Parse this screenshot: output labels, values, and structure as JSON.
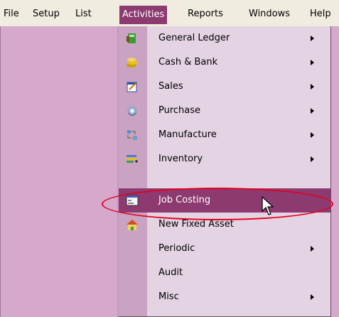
{
  "menubar": {
    "items": [
      "File",
      "Setup",
      "List",
      "Activities",
      "Reports",
      "Windows",
      "Help"
    ],
    "active_index": 3
  },
  "dropdown": {
    "items": [
      {
        "label": "General Ledger",
        "icon": "general-ledger-icon",
        "submenu": true
      },
      {
        "label": "Cash & Bank",
        "icon": "cash-bank-icon",
        "submenu": true
      },
      {
        "label": "Sales",
        "icon": "sales-icon",
        "submenu": true
      },
      {
        "label": "Purchase",
        "icon": "purchase-icon",
        "submenu": true
      },
      {
        "label": "Manufacture",
        "icon": "manufacture-icon",
        "submenu": true
      },
      {
        "label": "Inventory",
        "icon": "inventory-icon",
        "submenu": true
      },
      {
        "label": "Job Costing",
        "icon": "job-costing-icon",
        "submenu": false,
        "highlighted": true
      },
      {
        "label": "New Fixed Asset",
        "icon": "fixed-asset-icon",
        "submenu": false
      },
      {
        "label": "Periodic",
        "icon": "",
        "submenu": true
      },
      {
        "label": "Audit",
        "icon": "",
        "submenu": false
      },
      {
        "label": "Misc",
        "icon": "",
        "submenu": true
      }
    ]
  },
  "colors": {
    "menu_highlight": "#8c3a70",
    "desktop": "#d6a8cc",
    "annotation": "#e3001b"
  }
}
